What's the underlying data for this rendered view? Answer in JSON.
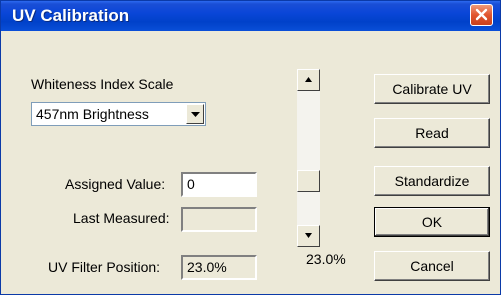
{
  "window": {
    "title": "UV Calibration"
  },
  "scale": {
    "label": "Whiteness Index Scale",
    "selected": "457nm Brightness"
  },
  "fields": {
    "assigned_label": "Assigned Value:",
    "assigned_value": "0",
    "measured_label": "Last Measured:",
    "measured_value": "",
    "filter_label": "UV Filter Position:",
    "filter_value": "23.0%"
  },
  "slider": {
    "value_text": "23.0%",
    "level_percent": 23.0
  },
  "buttons": {
    "calibrate": "Calibrate UV",
    "read": "Read",
    "standardize": "Standardize",
    "ok": "OK",
    "cancel": "Cancel"
  },
  "icons": {
    "close": "close-icon",
    "dropdown": "chevron-down-icon",
    "up": "arrow-up-icon",
    "down": "arrow-down-icon"
  }
}
